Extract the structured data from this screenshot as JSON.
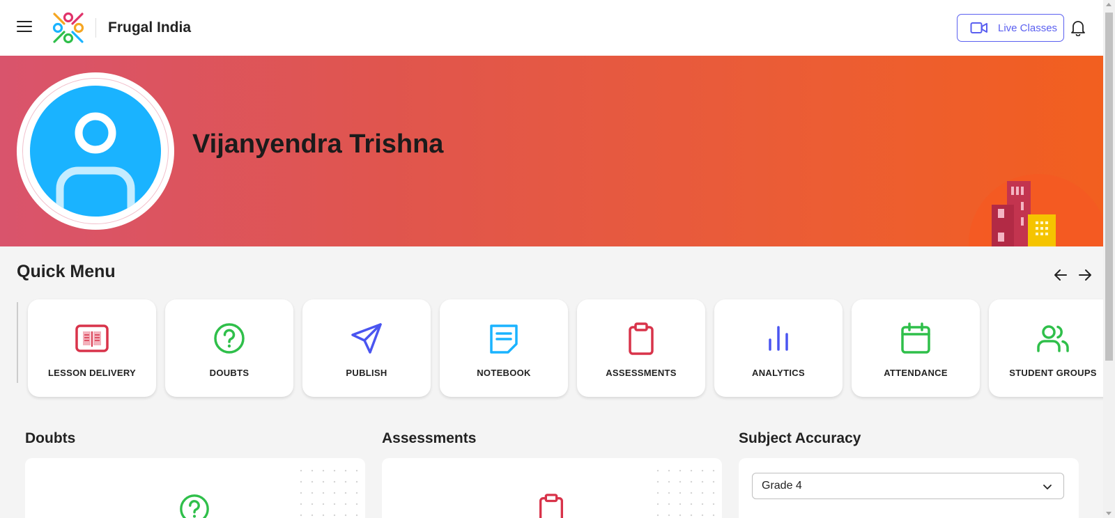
{
  "header": {
    "brand_name": "Frugal India",
    "live_button_label": "Live Classes",
    "accent_color": "#5a5ff0"
  },
  "profile": {
    "name": "Vijanyendra Trishna",
    "banner_colors": [
      "#d9546c",
      "#f25f1f"
    ]
  },
  "quick_menu": {
    "title": "Quick Menu",
    "items": [
      {
        "label": "LESSON DELIVERY",
        "icon": "book-icon",
        "color": "#d8334a"
      },
      {
        "label": "DOUBTS",
        "icon": "question-circle-icon",
        "color": "#2fbf4a"
      },
      {
        "label": "PUBLISH",
        "icon": "send-icon",
        "color": "#4a55f0"
      },
      {
        "label": "NOTEBOOK",
        "icon": "notebook-icon",
        "color": "#1ab3ff"
      },
      {
        "label": "ASSESSMENTS",
        "icon": "clipboard-icon",
        "color": "#d8334a"
      },
      {
        "label": "ANALYTICS",
        "icon": "bar-chart-icon",
        "color": "#4a55f0"
      },
      {
        "label": "ATTENDANCE",
        "icon": "calendar-icon",
        "color": "#2fbf4a"
      },
      {
        "label": "STUDENT GROUPS",
        "icon": "users-icon",
        "color": "#2fbf4a"
      }
    ]
  },
  "sections": {
    "doubts_title": "Doubts",
    "assessments_title": "Assessments",
    "subject_accuracy_title": "Subject Accuracy"
  },
  "subject_accuracy": {
    "selected_grade": "Grade 4"
  }
}
